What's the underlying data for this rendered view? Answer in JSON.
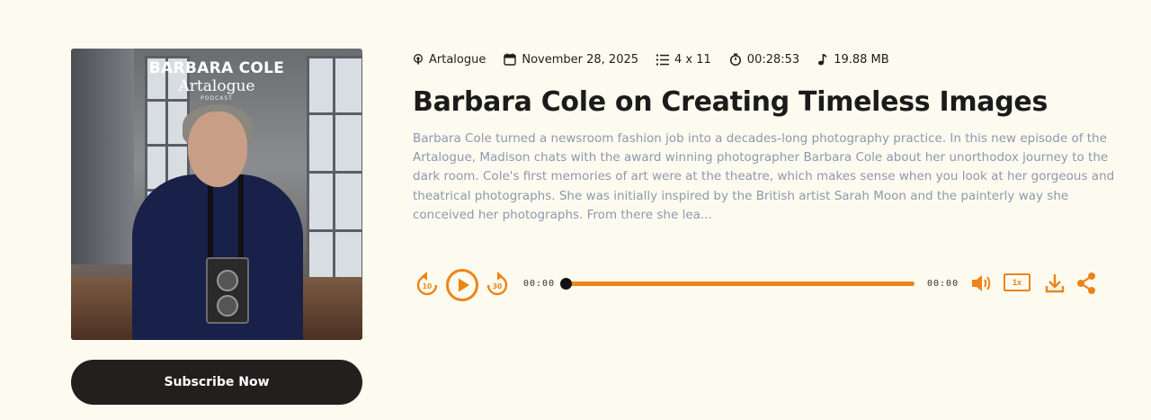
{
  "cover": {
    "title_line1": "BARBARA COLE",
    "title_line2": "Artalogue",
    "title_line3": "PODCAST"
  },
  "subscribe_label": "Subscribe Now",
  "meta": {
    "podcast": "Artalogue",
    "date": "November 28, 2025",
    "episode": "4 x 11",
    "duration": "00:28:53",
    "size": "19.88 MB",
    "icons": [
      "podcast-icon",
      "calendar-icon",
      "list-icon",
      "timer-icon",
      "music-note-icon"
    ]
  },
  "episode": {
    "title": "Barbara Cole on Creating Timeless Images",
    "description": "Barbara Cole turned a newsroom fashion job into a decades-long photography practice. In this new episode of the Artalogue, Madison chats with the award winning photographer Barbara Cole about her unorthodox journey to the dark room. Cole's first memories of art were at the theatre, which makes sense when you look at her gorgeous and theatrical photographs. She was initially inspired by the British artist Sarah Moon and the painterly way she conceived her photographs. From there she lea..."
  },
  "player": {
    "rewind_label": "10",
    "forward_label": "30",
    "current_time": "00:00",
    "total_time": "00:00",
    "progress": 0,
    "speed": "1x",
    "accent_color": "#ee8318"
  }
}
